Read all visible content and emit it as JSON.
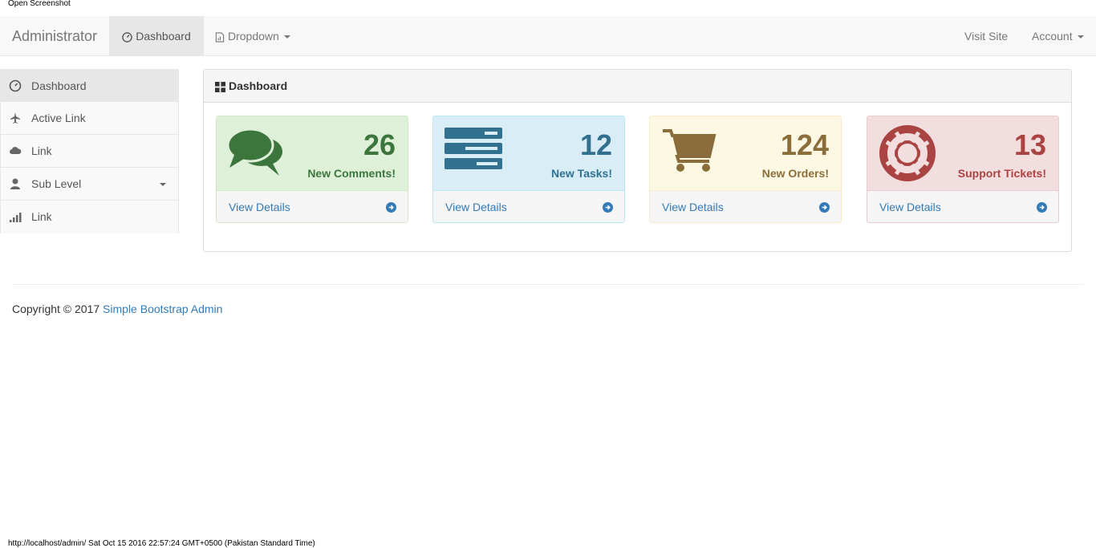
{
  "window": {
    "caption": "Open Screenshot"
  },
  "navbar": {
    "brand": "Administrator",
    "items": [
      {
        "label": "Dashboard",
        "icon": "dashboard-icon"
      },
      {
        "label": "Dropdown",
        "icon": "file-chart-icon"
      }
    ],
    "right": [
      {
        "label": "Visit Site"
      },
      {
        "label": "Account"
      }
    ]
  },
  "sidebar": {
    "items": [
      {
        "label": "Dashboard",
        "icon": "dashboard-icon"
      },
      {
        "label": "Active Link",
        "icon": "plane-icon"
      },
      {
        "label": "Link",
        "icon": "cloud-icon"
      },
      {
        "label": "Sub Level",
        "icon": "user-icon"
      },
      {
        "label": "Link",
        "icon": "signal-icon"
      }
    ]
  },
  "panel": {
    "title": "Dashboard",
    "icon": "th-large-icon"
  },
  "cards": [
    {
      "count": "26",
      "label": "New Comments!",
      "link": "View Details",
      "icon": "comments-icon",
      "color": "#3c763d"
    },
    {
      "count": "12",
      "label": "New Tasks!",
      "link": "View Details",
      "icon": "tasks-icon",
      "color": "#31708f"
    },
    {
      "count": "124",
      "label": "New Orders!",
      "link": "View Details",
      "icon": "shopping-cart-icon",
      "color": "#8a6d3b"
    },
    {
      "count": "13",
      "label": "Support Tickets!",
      "link": "View Details",
      "icon": "life-ring-icon",
      "color": "#a94442"
    }
  ],
  "footer": {
    "copyright": "Copyright © 2017",
    "link": "Simple Bootstrap Admin"
  },
  "status": {
    "text": "http://localhost/admin/ Sat Oct 15 2016 22:57:24 GMT+0500 (Pakistan Standard Time)"
  }
}
